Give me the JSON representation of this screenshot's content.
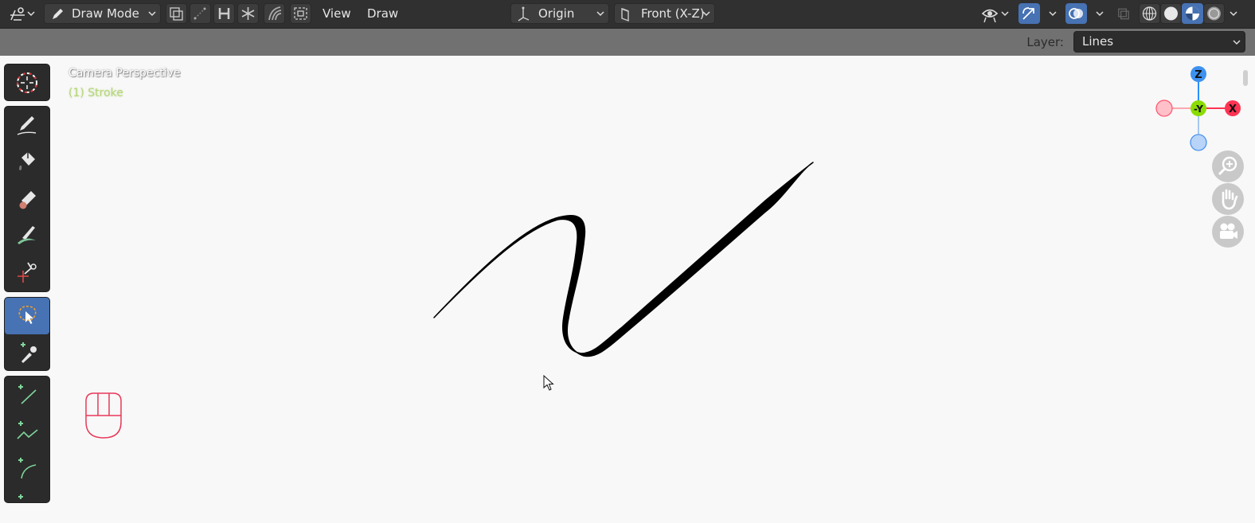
{
  "header": {
    "mode_label": "Draw Mode",
    "menus": [
      "View",
      "Draw"
    ],
    "pivot_label": "Origin",
    "orientation_label": "Front (X-Z)"
  },
  "tool_settings": {
    "layer_label": "Layer:",
    "layer_value": "Lines"
  },
  "viewport": {
    "camera_label": "Camera Perspective",
    "object_label": "(1) Stroke"
  },
  "gizmo": {
    "z_label": "Z",
    "y_label": "-Y",
    "x_label": "X"
  },
  "colors": {
    "header_bg": "#303030",
    "tool_settings_bg": "#717171",
    "viewport_bg": "#f8f8f8",
    "accent": "#4772b3",
    "axis_x": "#ff3352",
    "axis_y": "#8bdc00",
    "axis_z": "#2890ff"
  },
  "icons": {
    "editor_type": "grease-pencil-editor-icon",
    "tools": [
      "cursor-icon",
      "draw-pencil-icon",
      "fill-bucket-icon",
      "erase-icon",
      "tint-brush-icon",
      "cutter-icon",
      "select-lasso-icon",
      "eyedropper-icon",
      "line-icon",
      "polyline-icon",
      "arc-icon"
    ],
    "navigation": [
      "zoom-icon",
      "pan-hand-icon",
      "camera-icon"
    ]
  }
}
